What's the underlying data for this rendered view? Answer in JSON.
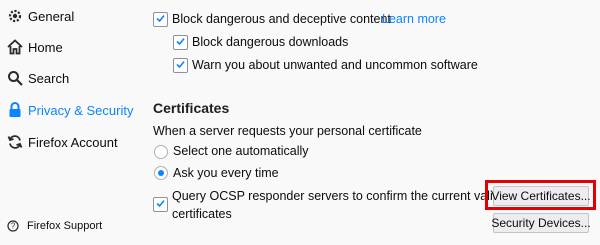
{
  "sidebar": {
    "items": [
      {
        "label": "General",
        "icon": "gear-icon"
      },
      {
        "label": "Home",
        "icon": "home-icon"
      },
      {
        "label": "Search",
        "icon": "search-icon"
      },
      {
        "label": "Privacy & Security",
        "icon": "lock-icon"
      },
      {
        "label": "Firefox Account",
        "icon": "sync-icon"
      }
    ],
    "support_label": "Firefox Support"
  },
  "security": {
    "block_deceptive_label": "Block dangerous and deceptive content",
    "learn_more_label": "Learn more",
    "block_downloads_label": "Block dangerous downloads",
    "warn_software_label": "Warn you about unwanted and uncommon software"
  },
  "certificates": {
    "heading": "Certificates",
    "request_text": "When a server requests your personal certificate",
    "select_auto_label": "Select one automatically",
    "ask_every_label": "Ask you every time",
    "ocsp_label_line1": "Query OCSP responder servers to confirm the current validity of",
    "ocsp_label_line2": "certificates",
    "view_certificates_label": "View Certificates...",
    "security_devices_label": "Security Devices..."
  },
  "colors": {
    "accent": "#0a84ff",
    "highlight_box": "#e30000"
  }
}
